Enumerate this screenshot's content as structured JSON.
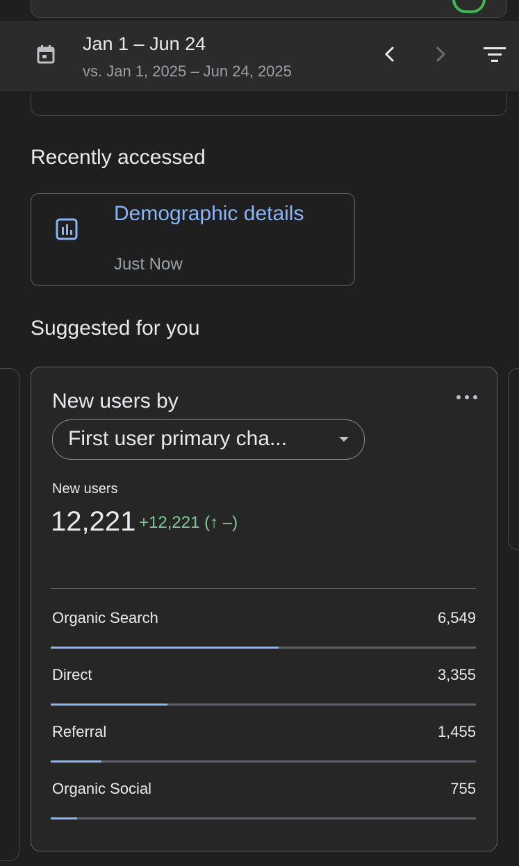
{
  "date_bar": {
    "range": "Jan 1 – Jun 24",
    "comparison": "vs. Jan 1, 2025 – Jun 24, 2025"
  },
  "recently_accessed": {
    "heading": "Recently accessed",
    "item": {
      "title": "Demographic details",
      "time": "Just Now"
    }
  },
  "suggested": {
    "heading": "Suggested for you",
    "card": {
      "title": "New users by",
      "dimension": "First user primary cha...",
      "metric_label": "New users",
      "metric_value": "12,221",
      "metric_change": "+12,221 (↑ –)",
      "rows": [
        {
          "label": "Organic Search",
          "value": "6,549",
          "share": 0.536
        },
        {
          "label": "Direct",
          "value": "3,355",
          "share": 0.275
        },
        {
          "label": "Referral",
          "value": "1,455",
          "share": 0.119
        },
        {
          "label": "Organic Social",
          "value": "755",
          "share": 0.062
        }
      ]
    }
  },
  "colors": {
    "accent": "#8ab4f8",
    "positive": "#81c995",
    "background": "#1f1f1f"
  },
  "icons": {
    "calendar": "calendar-icon",
    "prev": "chevron-left-icon",
    "next": "chevron-right-icon",
    "filter": "filter-icon",
    "report": "bar-chart-icon",
    "more": "more-horiz-icon"
  }
}
